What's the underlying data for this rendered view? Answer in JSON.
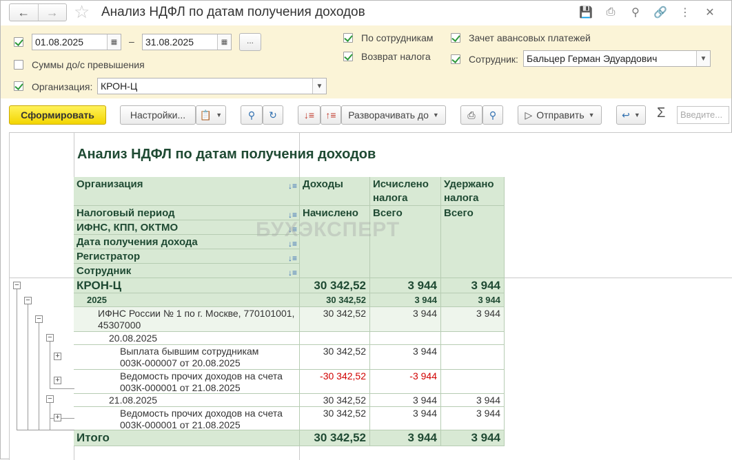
{
  "window": {
    "title": "Анализ НДФЛ по датам получения доходов",
    "nav": {
      "back_icon": "arrow-left-icon",
      "forward_icon": "arrow-right-icon"
    },
    "right_icons": [
      "save-icon",
      "print-icon",
      "preview-icon",
      "link-icon",
      "more-icon",
      "close-icon"
    ]
  },
  "filters": {
    "period": {
      "checked": true,
      "from": "01.08.2025",
      "dash": "–",
      "to": "31.08.2025",
      "dots": "..."
    },
    "sums_over": {
      "checked": false,
      "label": "Суммы до/с превышения"
    },
    "organization": {
      "checked": true,
      "label": "Организация:",
      "value": "КРОН-Ц"
    },
    "by_employees": {
      "checked": true,
      "label": "По сотрудникам"
    },
    "tax_refund": {
      "checked": true,
      "label": "Возврат налога"
    },
    "advance_offset": {
      "checked": true,
      "label": "Зачет авансовых платежей"
    },
    "employee": {
      "checked": true,
      "label": "Сотрудник:",
      "value": "Бальцер Герман Эдуардович"
    }
  },
  "toolbar": {
    "generate": "Сформировать",
    "settings": "Настройки...",
    "expand_to": "Разворачивать до",
    "send": "Отправить",
    "sigma": "Σ",
    "search_placeholder": "Введите..."
  },
  "report": {
    "title": "Анализ НДФЛ по датам получения доходов",
    "watermark": "БУХЭКСПЕРТ",
    "headers": {
      "organization": "Организация",
      "tax_period": "Налоговый период",
      "ifns": "ИФНС, КПП, ОКТМО",
      "income_date": "Дата получения дохода",
      "registrar": "Регистратор",
      "employee": "Сотрудник",
      "income": "Доходы",
      "accrued": "Начислено",
      "calculated": "Исчислено налога",
      "calc_total": "Всего",
      "withheld": "Удержано налога",
      "withheld_total": "Всего"
    },
    "rows": [
      {
        "label": "КРОН-Ц",
        "income": "30 342,52",
        "calc": "3 944",
        "withheld": "3 944"
      },
      {
        "label": "2025",
        "income": "30 342,52",
        "calc": "3 944",
        "withheld": "3 944"
      },
      {
        "label": "ИФНС России № 1 по г. Москве, 770101001, 45307000",
        "income": "30 342,52",
        "calc": "3 944",
        "withheld": "3 944"
      },
      {
        "label": "20.08.2025",
        "income": "",
        "calc": "",
        "withheld": ""
      },
      {
        "label": "Выплата бывшим сотрудникам 003К-000007 от 20.08.2025",
        "income": "30 342,52",
        "calc": "3 944",
        "withheld": ""
      },
      {
        "label": "Ведомость прочих доходов на счета 003К-000001 от 21.08.2025",
        "income": "-30 342,52",
        "calc": "-3 944",
        "withheld": ""
      },
      {
        "label": "21.08.2025",
        "income": "30 342,52",
        "calc": "3 944",
        "withheld": "3 944"
      },
      {
        "label": "Ведомость прочих доходов на счета 003К-000001 от 21.08.2025",
        "income": "30 342,52",
        "calc": "3 944",
        "withheld": "3 944"
      }
    ],
    "total": {
      "label": "Итого",
      "income": "30 342,52",
      "calc": "3 944",
      "withheld": "3 944"
    }
  }
}
